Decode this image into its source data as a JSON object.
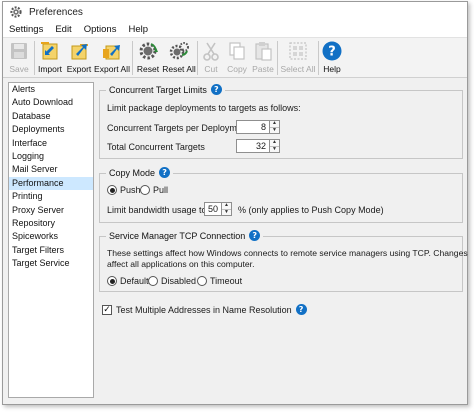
{
  "window": {
    "title": "Preferences"
  },
  "menu": [
    "Settings",
    "Edit",
    "Options",
    "Help"
  ],
  "toolbar": {
    "save": "Save",
    "import": "Import",
    "export": "Export",
    "export_all": "Export All",
    "reset": "Reset",
    "reset_all": "Reset All",
    "cut": "Cut",
    "copy": "Copy",
    "paste": "Paste",
    "select_all": "Select All",
    "help": "Help"
  },
  "sidebar": {
    "items": [
      "Alerts",
      "Auto Download",
      "Database",
      "Deployments",
      "Interface",
      "Logging",
      "Mail Server",
      "Performance",
      "Printing",
      "Proxy Server",
      "Repository",
      "Spiceworks",
      "Target Filters",
      "Target Service"
    ],
    "selected": "Performance"
  },
  "concurrent": {
    "title": "Concurrent Target Limits",
    "description": "Limit package deployments to targets as follows:",
    "per_deployment_label": "Concurrent Targets per Deployment",
    "per_deployment_value": "8",
    "total_label": "Total Concurrent Targets",
    "total_value": "32"
  },
  "copy_mode": {
    "title": "Copy Mode",
    "push": "Push",
    "pull": "Pull",
    "selected": "Push",
    "bandwidth_label": "Limit bandwidth usage to:",
    "bandwidth_value": "50",
    "bandwidth_suffix": "% (only applies to Push Copy Mode)"
  },
  "tcp": {
    "title": "Service Manager TCP Connection",
    "description_line1": "These settings affect how Windows connects to remote service managers using TCP. Changes",
    "description_line2": "affect all applications on this computer.",
    "default": "Default",
    "disabled": "Disabled",
    "timeout": "Timeout",
    "selected": "Default"
  },
  "test_multiple": {
    "label": "Test Multiple Addresses in Name Resolution",
    "checked": true
  },
  "colors": {
    "accent": "#1170c5",
    "selection": "#cde8ff",
    "reset_green": "#2e8b3a",
    "disabled_gray": "#c3c3c3"
  }
}
